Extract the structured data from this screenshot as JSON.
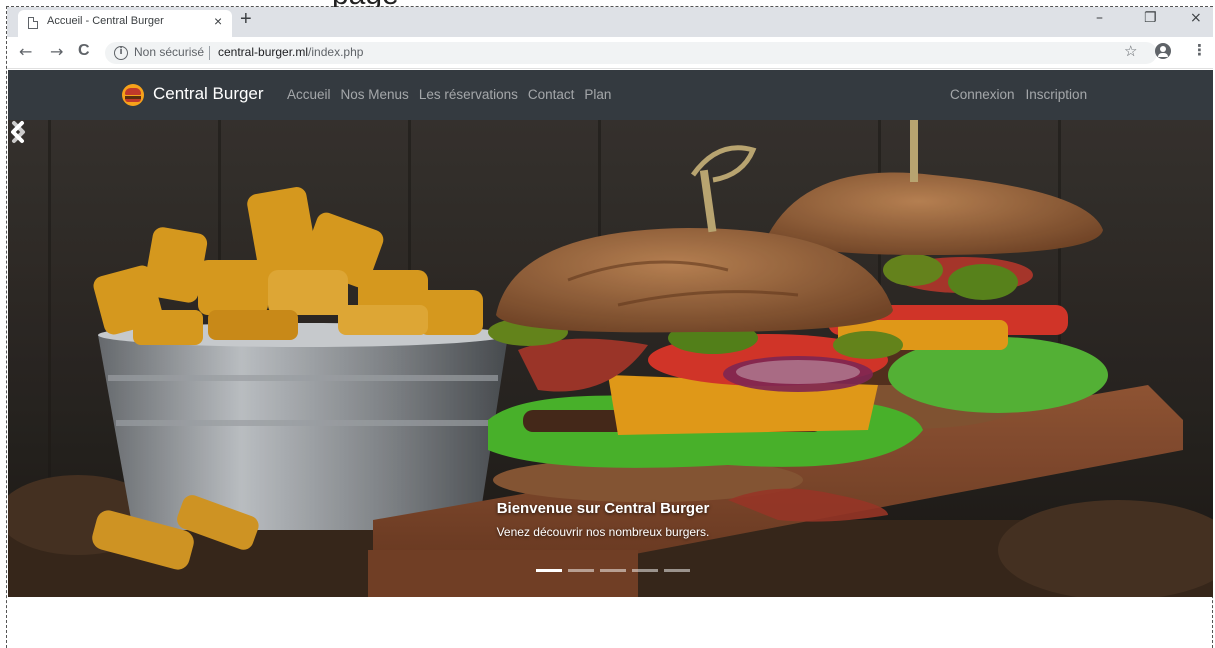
{
  "browser": {
    "tab_title": "Accueil - Central Burger",
    "tab_close": "×",
    "new_tab": "+",
    "security_label": "Non sécurisé",
    "url_host": "central-burger.ml",
    "url_path": "/index.php",
    "window_controls": {
      "minimize": "–",
      "restore": "❐",
      "close": "×"
    },
    "nav": {
      "back": "←",
      "forward": "→",
      "reload": "C"
    },
    "icons": {
      "info": "info-icon",
      "star": "star-icon",
      "account": "account-icon",
      "menu": "menu-icon"
    }
  },
  "navbar": {
    "brand": "Central Burger",
    "links": [
      "Accueil",
      "Nos Menus",
      "Les réservations",
      "Contact",
      "Plan"
    ],
    "right_links": [
      "Connexion",
      "Inscription"
    ],
    "background": "#343a40"
  },
  "hero": {
    "caption_title": "Bienvenue sur Central Burger",
    "caption_text": "Venez découvrir nos nombreux burgers.",
    "indicator_count": 5,
    "active_indicator": 0
  },
  "cropped_heading": "page"
}
